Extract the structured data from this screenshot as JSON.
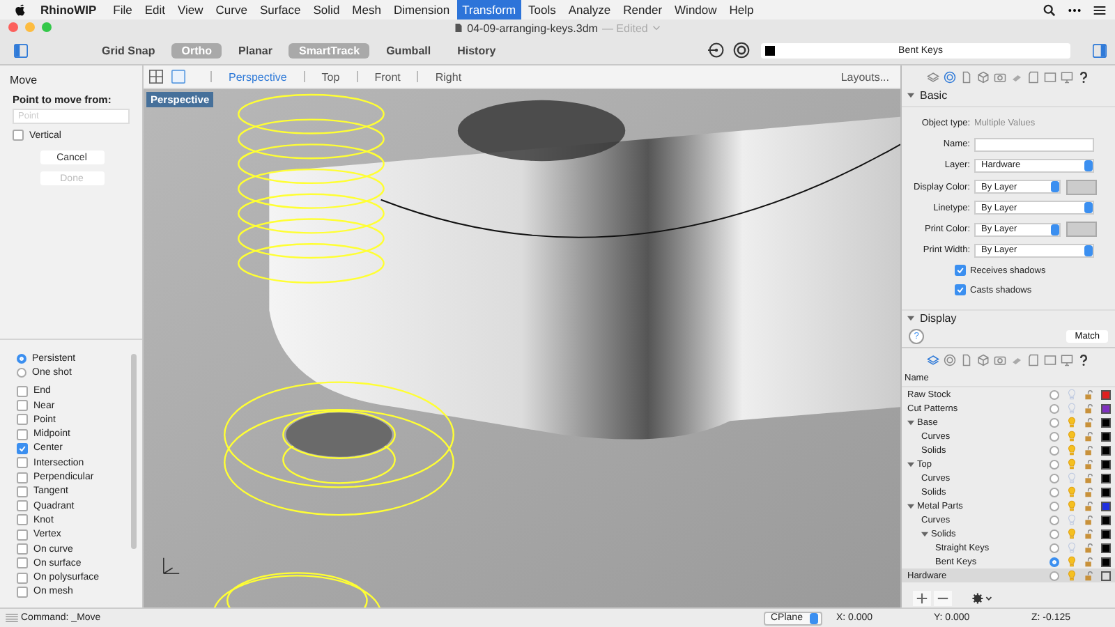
{
  "menu_bar": {
    "app": "RhinoWIP",
    "items": [
      {
        "label": "File",
        "selected": false
      },
      {
        "label": "Edit",
        "selected": false
      },
      {
        "label": "View",
        "selected": false
      },
      {
        "label": "Curve",
        "selected": false
      },
      {
        "label": "Surface",
        "selected": false
      },
      {
        "label": "Solid",
        "selected": false
      },
      {
        "label": "Mesh",
        "selected": false
      },
      {
        "label": "Dimension",
        "selected": false
      },
      {
        "label": "Transform",
        "selected": true
      },
      {
        "label": "Tools",
        "selected": false
      },
      {
        "label": "Analyze",
        "selected": false
      },
      {
        "label": "Render",
        "selected": false
      },
      {
        "label": "Window",
        "selected": false
      },
      {
        "label": "Help",
        "selected": false
      }
    ]
  },
  "window": {
    "title": "04-09-arranging-keys.3dm",
    "status": "— Edited"
  },
  "toolbar": {
    "toggles": [
      {
        "label": "Grid Snap",
        "on": false
      },
      {
        "label": "Ortho",
        "on": true
      },
      {
        "label": "Planar",
        "on": false
      },
      {
        "label": "SmartTrack",
        "on": true
      },
      {
        "label": "Gumball",
        "on": false
      },
      {
        "label": "History",
        "on": false
      }
    ],
    "layer_field": {
      "value": "Bent Keys"
    }
  },
  "command_panel": {
    "title": "Move",
    "prompt": "Point to move from:",
    "placeholder": "Point",
    "options": [
      {
        "label": "Vertical",
        "checked": false
      }
    ],
    "buttons": [
      {
        "label": "Cancel",
        "disabled": false
      },
      {
        "label": "Done",
        "disabled": true
      }
    ]
  },
  "osnap": {
    "modes": [
      {
        "label": "Persistent",
        "selected": true
      },
      {
        "label": "One shot",
        "selected": false
      }
    ],
    "snaps": [
      {
        "label": "End",
        "checked": false
      },
      {
        "label": "Near",
        "checked": false
      },
      {
        "label": "Point",
        "checked": false
      },
      {
        "label": "Midpoint",
        "checked": false
      },
      {
        "label": "Center",
        "checked": true
      },
      {
        "label": "Intersection",
        "checked": false
      },
      {
        "label": "Perpendicular",
        "checked": false
      },
      {
        "label": "Tangent",
        "checked": false
      },
      {
        "label": "Quadrant",
        "checked": false
      },
      {
        "label": "Knot",
        "checked": false
      },
      {
        "label": "Vertex",
        "checked": false
      },
      {
        "label": "On curve",
        "checked": false
      },
      {
        "label": "On surface",
        "checked": false
      },
      {
        "label": "On polysurface",
        "checked": false
      },
      {
        "label": "On mesh",
        "checked": false
      }
    ]
  },
  "viewport": {
    "tabs": [
      {
        "label": "Perspective",
        "selected": true
      },
      {
        "label": "Top",
        "selected": false
      },
      {
        "label": "Front",
        "selected": false
      },
      {
        "label": "Right",
        "selected": false
      }
    ],
    "layouts": "Layouts...",
    "label": "Perspective"
  },
  "properties": {
    "section": "Basic",
    "object_type_label": "Object type:",
    "object_type_value": "Multiple Values",
    "fields": [
      {
        "label": "Name:",
        "kind": "text"
      },
      {
        "label": "Layer:",
        "value": "Hardware",
        "kind": "select"
      },
      {
        "label": "Display Color:",
        "value": "By Layer",
        "kind": "select-swatch"
      },
      {
        "label": "Linetype:",
        "value": "By Layer",
        "kind": "select"
      },
      {
        "label": "Print Color:",
        "value": "By Layer",
        "kind": "select-swatch"
      },
      {
        "label": "Print Width:",
        "value": "By Layer",
        "kind": "select"
      }
    ],
    "checks": [
      {
        "label": "Receives shadows",
        "checked": true
      },
      {
        "label": "Casts shadows",
        "checked": true
      }
    ],
    "next_section": "Display",
    "help": "?",
    "match": "Match"
  },
  "layers": {
    "header": "Name",
    "items": [
      {
        "name": "Raw Stock",
        "current": false,
        "visible": false,
        "color": "#e02020",
        "selected": false
      },
      {
        "name": "Cut Patterns",
        "current": false,
        "visible": false,
        "color": "#8030c0",
        "selected": false
      },
      {
        "name": "Base",
        "expanded": true,
        "current": false,
        "visible": true,
        "color": "#000000",
        "selected": false,
        "children": [
          {
            "name": "Curves",
            "current": false,
            "visible": true,
            "color": "#000000",
            "selected": false
          },
          {
            "name": "Solids",
            "current": false,
            "visible": true,
            "color": "#000000",
            "selected": false
          }
        ]
      },
      {
        "name": "Top",
        "expanded": true,
        "current": false,
        "visible": true,
        "color": "#000000",
        "selected": false,
        "children": [
          {
            "name": "Curves",
            "current": false,
            "visible": false,
            "color": "#000000",
            "selected": false
          },
          {
            "name": "Solids",
            "current": false,
            "visible": true,
            "color": "#000000",
            "selected": false
          }
        ]
      },
      {
        "name": "Metal Parts",
        "expanded": true,
        "current": false,
        "visible": true,
        "color": "#2030e0",
        "selected": false,
        "children": [
          {
            "name": "Curves",
            "current": false,
            "visible": false,
            "color": "#000000",
            "selected": false
          },
          {
            "name": "Solids",
            "expanded": true,
            "current": false,
            "visible": true,
            "color": "#000000",
            "selected": false,
            "children": [
              {
                "name": "Straight Keys",
                "current": false,
                "visible": false,
                "color": "#000000",
                "selected": false
              },
              {
                "name": "Bent Keys",
                "current": true,
                "visible": true,
                "color": "#000000",
                "selected": false
              }
            ]
          }
        ]
      },
      {
        "name": "Hardware",
        "current": false,
        "visible": true,
        "color": "#dddddd",
        "selected": true
      }
    ]
  },
  "status_bar": {
    "command": "Command: _Move",
    "cplane": "CPlane",
    "x": "X: 0.000",
    "y": "Y: 0.000",
    "z": "Z: -0.125"
  }
}
